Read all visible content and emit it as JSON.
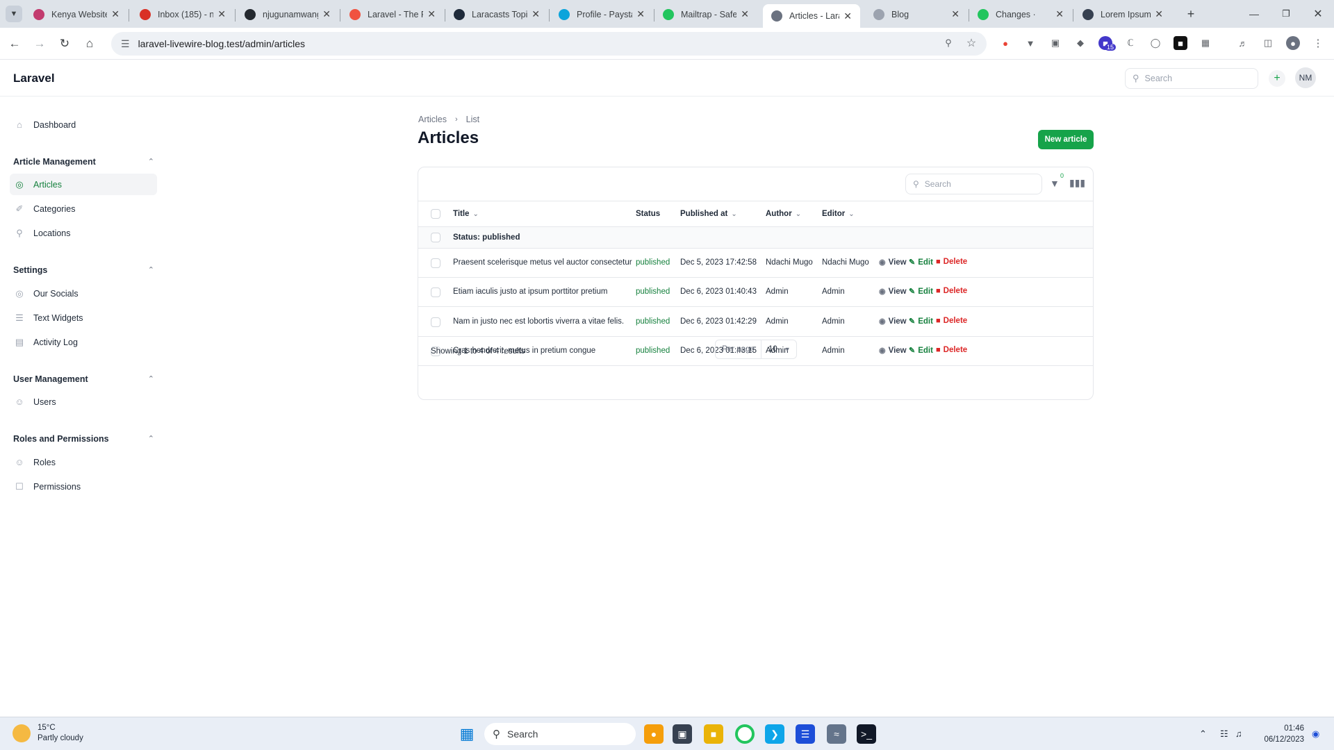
{
  "browser": {
    "tabs": [
      {
        "title": "Kenya Website",
        "color": "#c23b6e"
      },
      {
        "title": "Inbox (185) - n",
        "color": "#d93025"
      },
      {
        "title": "njugunamwang",
        "color": "#24292f"
      },
      {
        "title": "Laravel - The P",
        "color": "#f05340"
      },
      {
        "title": "Laracasts Topic",
        "color": "#1e2a3a"
      },
      {
        "title": "Profile - Paysta",
        "color": "#0ba4db"
      },
      {
        "title": "Mailtrap - Safe",
        "color": "#22c55e"
      },
      {
        "title": "Articles - Larav",
        "color": "#6b7280"
      },
      {
        "title": "Blog",
        "color": "#9ca3af"
      },
      {
        "title": "Changes ·",
        "color": "#22c55e"
      },
      {
        "title": "Lorem Ipsum -",
        "color": "#374151"
      }
    ],
    "url": "laravel-livewire-blog.test/admin/articles",
    "extension_badge": "15"
  },
  "app": {
    "brand": "Laravel",
    "search_placeholder": "Search",
    "user_initials": "NM"
  },
  "sidebar": {
    "dashboard": "Dashboard",
    "groups": {
      "article_management": "Article Management",
      "settings": "Settings",
      "user_management": "User Management",
      "roles_permissions": "Roles and Permissions"
    },
    "items": {
      "articles": "Articles",
      "categories": "Categories",
      "locations": "Locations",
      "our_socials": "Our Socials",
      "text_widgets": "Text Widgets",
      "activity_log": "Activity Log",
      "users": "Users",
      "roles": "Roles",
      "permissions": "Permissions"
    }
  },
  "main": {
    "breadcrumb": [
      "Articles",
      "List"
    ],
    "title": "Articles",
    "new_button": "New article",
    "table_search_placeholder": "Search",
    "filter_count": "0",
    "columns": {
      "title": "Title",
      "status": "Status",
      "published_at": "Published at",
      "author": "Author",
      "editor": "Editor"
    },
    "group_label": "Status: published",
    "rows": [
      {
        "title": "Praesent scelerisque metus vel auctor consectetur",
        "status": "published",
        "published_at": "Dec 5, 2023 17:42:58",
        "author": "Ndachi Mugo",
        "editor": "Ndachi Mugo"
      },
      {
        "title": "Etiam iaculis justo at ipsum porttitor pretium",
        "status": "published",
        "published_at": "Dec 6, 2023 01:40:43",
        "author": "Admin",
        "editor": "Admin"
      },
      {
        "title": "Nam in justo nec est lobortis viverra a vitae felis.",
        "status": "published",
        "published_at": "Dec 6, 2023 01:42:29",
        "author": "Admin",
        "editor": "Admin"
      },
      {
        "title": "Cras hendrerit, metus in pretium congue",
        "status": "published",
        "published_at": "Dec 6, 2023 01:43:15",
        "author": "Admin",
        "editor": "Admin"
      }
    ],
    "actions": {
      "view": "View",
      "edit": "Edit",
      "delete": "Delete"
    },
    "showing": "Showing 1 to 4 of 4 results",
    "per_page_label": "Per page",
    "per_page_value": "10"
  },
  "taskbar": {
    "temperature": "15°C",
    "weather": "Partly cloudy",
    "search": "Search",
    "time": "01:46",
    "date": "06/12/2023"
  },
  "colors": {
    "accent": "#16a34a",
    "danger": "#dc2626"
  }
}
